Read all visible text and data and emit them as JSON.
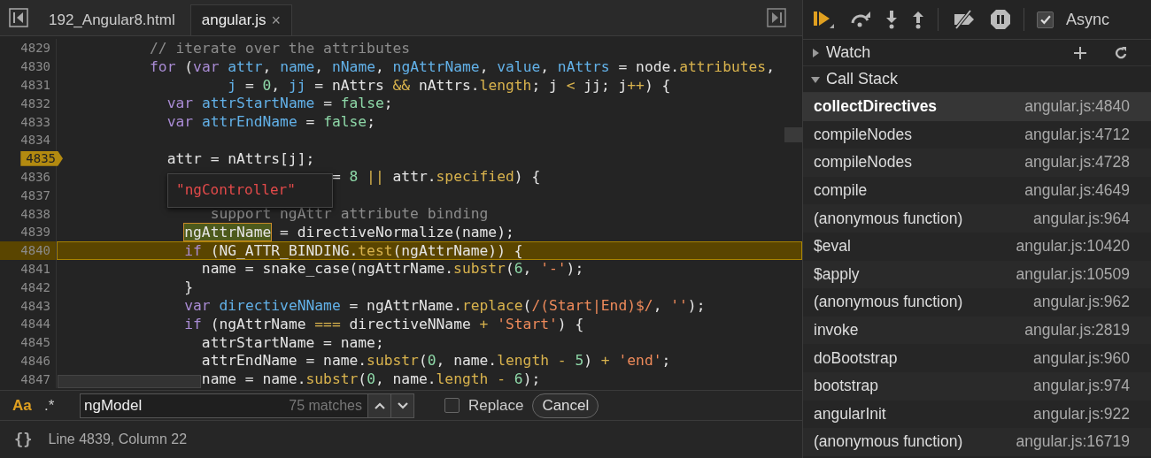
{
  "tabs": [
    {
      "label": "192_Angular8.html",
      "selected": false,
      "closable": false
    },
    {
      "label": "angular.js",
      "selected": true,
      "closable": true
    }
  ],
  "close_glyph": "×",
  "editor": {
    "lines": [
      {
        "number": "4829",
        "breakpoint": false,
        "current": false,
        "tokens": [
          {
            "text": "          // iterate over the attributes",
            "kind": "comment"
          }
        ]
      },
      {
        "number": "4830",
        "breakpoint": false,
        "current": false,
        "tokens": [
          {
            "text": "          for",
            "kind": "keyword"
          },
          {
            "text": " (",
            "kind": "plain"
          },
          {
            "text": "var",
            "kind": "keyword"
          },
          {
            "text": " attr",
            "kind": "def"
          },
          {
            "text": ", ",
            "kind": "plain"
          },
          {
            "text": "name",
            "kind": "def"
          },
          {
            "text": ", ",
            "kind": "plain"
          },
          {
            "text": "nName",
            "kind": "def"
          },
          {
            "text": ", ",
            "kind": "plain"
          },
          {
            "text": "ngAttrName",
            "kind": "def"
          },
          {
            "text": ", ",
            "kind": "plain"
          },
          {
            "text": "value",
            "kind": "def"
          },
          {
            "text": ", ",
            "kind": "plain"
          },
          {
            "text": "nAttrs",
            "kind": "def"
          },
          {
            "text": " = node.",
            "kind": "plain"
          },
          {
            "text": "attributes",
            "kind": "prop"
          },
          {
            "text": ",",
            "kind": "plain"
          }
        ]
      },
      {
        "number": "4831",
        "breakpoint": false,
        "current": false,
        "tokens": [
          {
            "text": "                   j",
            "kind": "def"
          },
          {
            "text": " = ",
            "kind": "plain"
          },
          {
            "text": "0",
            "kind": "num"
          },
          {
            "text": ", ",
            "kind": "plain"
          },
          {
            "text": "jj",
            "kind": "def"
          },
          {
            "text": " = nAttrs ",
            "kind": "plain"
          },
          {
            "text": "&&",
            "kind": "op"
          },
          {
            "text": " nAttrs.",
            "kind": "plain"
          },
          {
            "text": "length",
            "kind": "prop"
          },
          {
            "text": "; j ",
            "kind": "plain"
          },
          {
            "text": "<",
            "kind": "op"
          },
          {
            "text": " jj; j",
            "kind": "plain"
          },
          {
            "text": "++",
            "kind": "op"
          },
          {
            "text": ") {",
            "kind": "plain"
          }
        ]
      },
      {
        "number": "4832",
        "breakpoint": false,
        "current": false,
        "tokens": [
          {
            "text": "            var",
            "kind": "keyword"
          },
          {
            "text": " attrStartName",
            "kind": "def"
          },
          {
            "text": " = ",
            "kind": "plain"
          },
          {
            "text": "false",
            "kind": "num"
          },
          {
            "text": ";",
            "kind": "plain"
          }
        ]
      },
      {
        "number": "4833",
        "breakpoint": false,
        "current": false,
        "tokens": [
          {
            "text": "            var",
            "kind": "keyword"
          },
          {
            "text": " attrEndName",
            "kind": "def"
          },
          {
            "text": " = ",
            "kind": "plain"
          },
          {
            "text": "false",
            "kind": "num"
          },
          {
            "text": ";",
            "kind": "plain"
          }
        ]
      },
      {
        "number": "4834",
        "breakpoint": false,
        "current": false
      },
      {
        "number": "4835",
        "breakpoint": true,
        "current": false,
        "tokens": [
          {
            "text": "            attr = nAttrs[j];",
            "kind": "plain"
          }
        ]
      },
      {
        "number": "4836",
        "breakpoint": false,
        "current": false,
        "tokens": [
          {
            "text": "                               = ",
            "kind": "plain"
          },
          {
            "text": "8",
            "kind": "num"
          },
          {
            "text": " ||",
            "kind": "op"
          },
          {
            "text": " attr.",
            "kind": "plain"
          },
          {
            "text": "specified",
            "kind": "prop"
          },
          {
            "text": ") {",
            "kind": "plain"
          }
        ]
      },
      {
        "number": "4837",
        "breakpoint": false,
        "current": false
      },
      {
        "number": "4838",
        "breakpoint": false,
        "current": false,
        "tokens": [
          {
            "text": "                 support ngAttr attribute binding",
            "kind": "comment"
          }
        ]
      },
      {
        "number": "4839",
        "breakpoint": false,
        "current": false,
        "tokens": [
          {
            "text": "              ngAttrName",
            "kind": "hovered"
          },
          {
            "text": " = directiveNormalize(name);",
            "kind": "plain"
          }
        ]
      },
      {
        "number": "4840",
        "breakpoint": false,
        "current": true,
        "tokens": [
          {
            "text": "              if",
            "kind": "keyword"
          },
          {
            "text": " (NG_ATTR_BINDING.",
            "kind": "plain"
          },
          {
            "text": "test",
            "kind": "prop"
          },
          {
            "text": "(ngAttrName)) {",
            "kind": "plain"
          }
        ]
      },
      {
        "number": "4841",
        "breakpoint": false,
        "current": false,
        "tokens": [
          {
            "text": "                name = snake_case(ngAttrName.",
            "kind": "plain"
          },
          {
            "text": "substr",
            "kind": "prop"
          },
          {
            "text": "(",
            "kind": "plain"
          },
          {
            "text": "6",
            "kind": "num"
          },
          {
            "text": ", ",
            "kind": "plain"
          },
          {
            "text": "'-'",
            "kind": "str"
          },
          {
            "text": ");",
            "kind": "plain"
          }
        ]
      },
      {
        "number": "4842",
        "breakpoint": false,
        "current": false,
        "tokens": [
          {
            "text": "              }",
            "kind": "plain"
          }
        ]
      },
      {
        "number": "4843",
        "breakpoint": false,
        "current": false,
        "tokens": [
          {
            "text": "              var",
            "kind": "keyword"
          },
          {
            "text": " directiveNName",
            "kind": "def"
          },
          {
            "text": " = ngAttrName.",
            "kind": "plain"
          },
          {
            "text": "replace",
            "kind": "prop"
          },
          {
            "text": "(",
            "kind": "plain"
          },
          {
            "text": "/(Start|End)$/",
            "kind": "str"
          },
          {
            "text": ", ",
            "kind": "plain"
          },
          {
            "text": "''",
            "kind": "str"
          },
          {
            "text": ");",
            "kind": "plain"
          }
        ]
      },
      {
        "number": "4844",
        "breakpoint": false,
        "current": false,
        "tokens": [
          {
            "text": "              if",
            "kind": "keyword"
          },
          {
            "text": " (ngAttrName ",
            "kind": "plain"
          },
          {
            "text": "===",
            "kind": "op"
          },
          {
            "text": " directiveNName ",
            "kind": "plain"
          },
          {
            "text": "+",
            "kind": "op"
          },
          {
            "text": " 'Start'",
            "kind": "str"
          },
          {
            "text": ") {",
            "kind": "plain"
          }
        ]
      },
      {
        "number": "4845",
        "breakpoint": false,
        "current": false,
        "tokens": [
          {
            "text": "                attrStartName = name;",
            "kind": "plain"
          }
        ]
      },
      {
        "number": "4846",
        "breakpoint": false,
        "current": false,
        "tokens": [
          {
            "text": "                attrEndName = name.",
            "kind": "plain"
          },
          {
            "text": "substr",
            "kind": "prop"
          },
          {
            "text": "(",
            "kind": "plain"
          },
          {
            "text": "0",
            "kind": "num"
          },
          {
            "text": ", name.",
            "kind": "plain"
          },
          {
            "text": "length",
            "kind": "prop"
          },
          {
            "text": " -",
            "kind": "op"
          },
          {
            "text": " 5",
            "kind": "num"
          },
          {
            "text": ") ",
            "kind": "plain"
          },
          {
            "text": "+",
            "kind": "op"
          },
          {
            "text": " 'end'",
            "kind": "str"
          },
          {
            "text": ";",
            "kind": "plain"
          }
        ]
      },
      {
        "number": "4847",
        "breakpoint": false,
        "current": false,
        "tokens": [
          {
            "text": "                name = name.",
            "kind": "plain"
          },
          {
            "text": "substr",
            "kind": "prop"
          },
          {
            "text": "(",
            "kind": "plain"
          },
          {
            "text": "0",
            "kind": "num"
          },
          {
            "text": ", name.",
            "kind": "plain"
          },
          {
            "text": "length",
            "kind": "prop"
          },
          {
            "text": " -",
            "kind": "op"
          },
          {
            "text": " 6",
            "kind": "num"
          },
          {
            "text": ");",
            "kind": "plain"
          }
        ]
      }
    ],
    "tooltip": {
      "value": "\"ngController\""
    }
  },
  "search": {
    "toggles": [
      {
        "label": "Aa",
        "on": true
      },
      {
        "label": ".*",
        "on": false
      }
    ],
    "value": "ngModel",
    "matches": "75 matches",
    "replace": {
      "label": "Replace",
      "checked": false
    },
    "cancel": "Cancel"
  },
  "status_bar": {
    "format_glyph": "{}",
    "position": "Line 4839, Column 22"
  },
  "debugger": {
    "async": {
      "label": "Async",
      "checked": true
    },
    "sections": [
      {
        "title": "Watch",
        "expanded": false
      },
      {
        "title": "Call Stack",
        "expanded": true
      }
    ],
    "call_stack": [
      {
        "name": "collectDirectives",
        "location": "angular.js:4840",
        "selected": true
      },
      {
        "name": "compileNodes",
        "location": "angular.js:4712",
        "selected": false
      },
      {
        "name": "compileNodes",
        "location": "angular.js:4728",
        "selected": false
      },
      {
        "name": "compile",
        "location": "angular.js:4649",
        "selected": false
      },
      {
        "name": "(anonymous function)",
        "location": "angular.js:964",
        "selected": false
      },
      {
        "name": "$eval",
        "location": "angular.js:10420",
        "selected": false
      },
      {
        "name": "$apply",
        "location": "angular.js:10509",
        "selected": false
      },
      {
        "name": "(anonymous function)",
        "location": "angular.js:962",
        "selected": false
      },
      {
        "name": "invoke",
        "location": "angular.js:2819",
        "selected": false
      },
      {
        "name": "doBootstrap",
        "location": "angular.js:960",
        "selected": false
      },
      {
        "name": "bootstrap",
        "location": "angular.js:974",
        "selected": false
      },
      {
        "name": "angularInit",
        "location": "angular.js:922",
        "selected": false
      },
      {
        "name": "(anonymous function)",
        "location": "angular.js:16719",
        "selected": false
      }
    ]
  }
}
